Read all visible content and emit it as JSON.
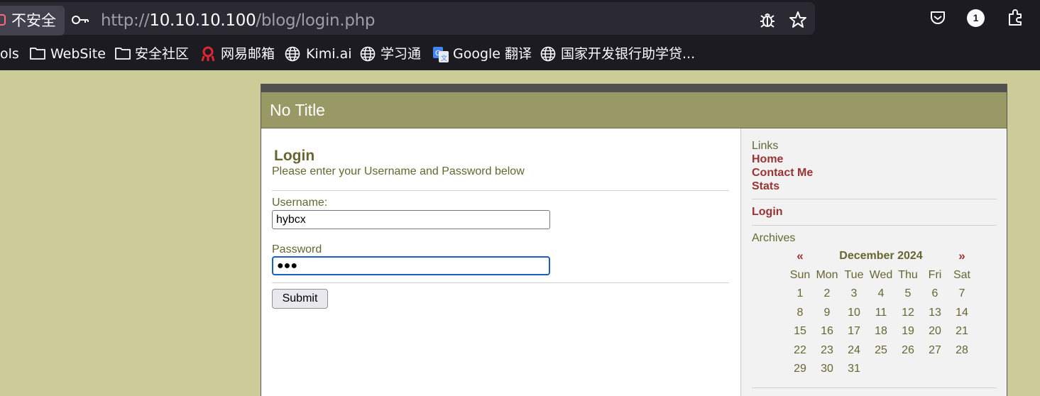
{
  "browser": {
    "security_label": "不安全",
    "url_prefix": "http://",
    "url_host": "10.10.10.100",
    "url_path": "/blog/login.php",
    "extensions_badge": "1"
  },
  "bookmarks": [
    {
      "label": "ols",
      "icon": "none"
    },
    {
      "label": "WebSite",
      "icon": "folder-icon"
    },
    {
      "label": "安全社区",
      "icon": "folder-icon"
    },
    {
      "label": "网易邮箱",
      "icon": "netease-mail-icon"
    },
    {
      "label": "Kimi.ai",
      "icon": "globe-icon"
    },
    {
      "label": "学习通",
      "icon": "globe-icon"
    },
    {
      "label": "Google 翻译",
      "icon": "google-translate-icon"
    },
    {
      "label": "国家开发银行助学贷...",
      "icon": "globe-icon"
    }
  ],
  "page": {
    "title": "No Title",
    "login": {
      "heading": "Login",
      "subtitle": "Please enter your Username and Password below",
      "username_label": "Username:",
      "username_value": "hybcx",
      "password_label": "Password",
      "password_mask": "●●●",
      "submit_label": "Submit"
    },
    "sidebar": {
      "links_heading": "Links",
      "links": [
        "Home",
        "Contact Me",
        "Stats"
      ],
      "login_link": "Login",
      "archives_heading": "Archives",
      "calendar": {
        "prev": "«",
        "next": "»",
        "month": "December 2024",
        "weekdays": [
          "Sun",
          "Mon",
          "Tue",
          "Wed",
          "Thu",
          "Fri",
          "Sat"
        ],
        "weeks": [
          [
            "1",
            "2",
            "3",
            "4",
            "5",
            "6",
            "7"
          ],
          [
            "8",
            "9",
            "10",
            "11",
            "12",
            "13",
            "14"
          ],
          [
            "15",
            "16",
            "17",
            "18",
            "19",
            "20",
            "21"
          ],
          [
            "22",
            "23",
            "24",
            "25",
            "26",
            "27",
            "28"
          ],
          [
            "29",
            "30",
            "31",
            "",
            "",
            "",
            ""
          ]
        ]
      }
    }
  },
  "colors": {
    "page_background": "#cccc99",
    "title_bar": "#999966",
    "text": "#666633",
    "link": "#993333",
    "focus_ring": "#1a5fc9"
  }
}
